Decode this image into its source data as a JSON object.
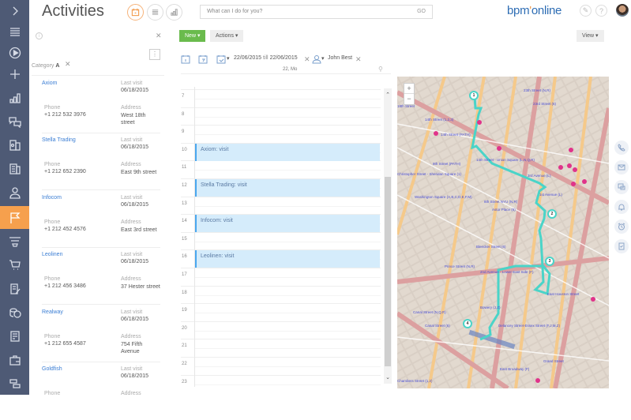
{
  "header": {
    "title": "Activities",
    "search_placeholder": "What can I do for you?",
    "search_go": "GO",
    "logo_text": "bpm",
    "logo_accent": "'",
    "logo_rest": "online",
    "view_modes": [
      "calendar-view",
      "list-view",
      "analytics-view"
    ]
  },
  "sidebar": {
    "items": [
      {
        "icon": "expand-icon"
      },
      {
        "icon": "menu-icon"
      },
      {
        "icon": "play-icon"
      },
      {
        "icon": "plus-icon"
      },
      {
        "icon": "dashboard-icon"
      },
      {
        "icon": "feed-icon"
      },
      {
        "icon": "contacts-icon"
      },
      {
        "icon": "accounts-icon"
      },
      {
        "icon": "user-icon"
      },
      {
        "icon": "activities-icon",
        "active": true
      },
      {
        "icon": "funnel-icon"
      },
      {
        "icon": "cart-icon"
      },
      {
        "icon": "document-edit-icon"
      },
      {
        "icon": "coins-icon"
      },
      {
        "icon": "document-icon"
      },
      {
        "icon": "case-icon"
      },
      {
        "icon": "process-icon"
      }
    ]
  },
  "toolbar": {
    "new_label": "New",
    "actions_label": "Actions",
    "view_label": "View"
  },
  "filter": {
    "category_label": "Category",
    "category_value": "A",
    "date_from": "22/06/2015",
    "till": "till",
    "date_to": "22/06/2015",
    "owner": "John Best",
    "day_header": "22, Mo"
  },
  "accounts": [
    {
      "name": "Axiom",
      "last_visit_label": "Last visit",
      "last_visit": "06/18/2015",
      "phone_label": "Phone",
      "phone": "+1 212 532 3976",
      "address_label": "Address",
      "address": "West 18th street"
    },
    {
      "name": "Stella Trading",
      "last_visit_label": "Last visit",
      "last_visit": "06/18/2015",
      "phone_label": "Phone",
      "phone": "+1 212 652 2390",
      "address_label": "Address",
      "address": "East 9th street"
    },
    {
      "name": "Infocom",
      "last_visit_label": "Last visit",
      "last_visit": "06/18/2015",
      "phone_label": "Phone",
      "phone": "+1 212 452 4576",
      "address_label": "Address",
      "address": "East 3rd street"
    },
    {
      "name": "Leolinen",
      "last_visit_label": "Last visit",
      "last_visit": "06/18/2015",
      "phone_label": "Phone",
      "phone": "+1 212 456 3486",
      "address_label": "Address",
      "address": "37 Hester street"
    },
    {
      "name": "Realway",
      "last_visit_label": "Last visit",
      "last_visit": "06/18/2015",
      "phone_label": "Phone",
      "phone": "+1 212 655 4587",
      "address_label": "Address",
      "address": "754 Fifth Avenue"
    },
    {
      "name": "Goldfish",
      "last_visit_label": "Last visit",
      "last_visit": "06/18/2015",
      "phone_label": "Phone",
      "phone": "",
      "address_label": "Address",
      "address": ""
    }
  ],
  "calendar": {
    "hours": [
      "7",
      "8",
      "9",
      "10",
      "11",
      "12",
      "13",
      "14",
      "15",
      "16",
      "17",
      "18",
      "19",
      "20",
      "21",
      "22",
      "23"
    ],
    "events": [
      {
        "title": "Axiom: visit",
        "hour": 10
      },
      {
        "title": "Stella Trading: visit",
        "hour": 12
      },
      {
        "title": "Infocom: visit",
        "hour": 14
      },
      {
        "title": "Leolinen: visit",
        "hour": 16
      }
    ]
  },
  "map": {
    "zoom_in": "+",
    "zoom_out": "−",
    "route_pins": [
      "1",
      "2",
      "3",
      "4"
    ],
    "labels": [
      "18th Street",
      "23th Street (N,R)",
      "23rd Street (6)",
      "14th Street (1,2,3)",
      "14th Street (PATH)",
      "14th Street - Union Square (L,N,Q,R)",
      "9th Street (PATH)",
      "Christopher Street - Sheridan Square (1)",
      "3rd Avenue (L)",
      "1st Avenue (L)",
      "Washington Square (A,B,C,D,E,F,M)",
      "8th Street NYU (N,R)",
      "Astor Place (6)",
      "Bleecker Street (6)",
      "Prince Street (N,R)",
      "2nd Avenue - Lower East Side (F)",
      "Bowery (J,Z)",
      "Canal Street (N,Q,R)",
      "Canal Street (6)",
      "Delancey Street-Essex Street (F,J,M,Z)",
      "East Broadway (F)",
      "Chambers Street (1,2)",
      "East Houston Street",
      "Grand Street"
    ]
  },
  "right_bar": [
    "phone-icon",
    "email-icon",
    "chat-icon",
    "bell-icon",
    "alarm-icon",
    "task-icon"
  ],
  "colors": {
    "sidebar_bg": "#4e5a75",
    "active_orange": "#f6a04d",
    "new_green": "#6abb4d",
    "event_bg": "#d5ecfb",
    "event_border": "#4aa7ef",
    "link_blue": "#3b7ed4",
    "route_teal": "#4ad4c8"
  }
}
